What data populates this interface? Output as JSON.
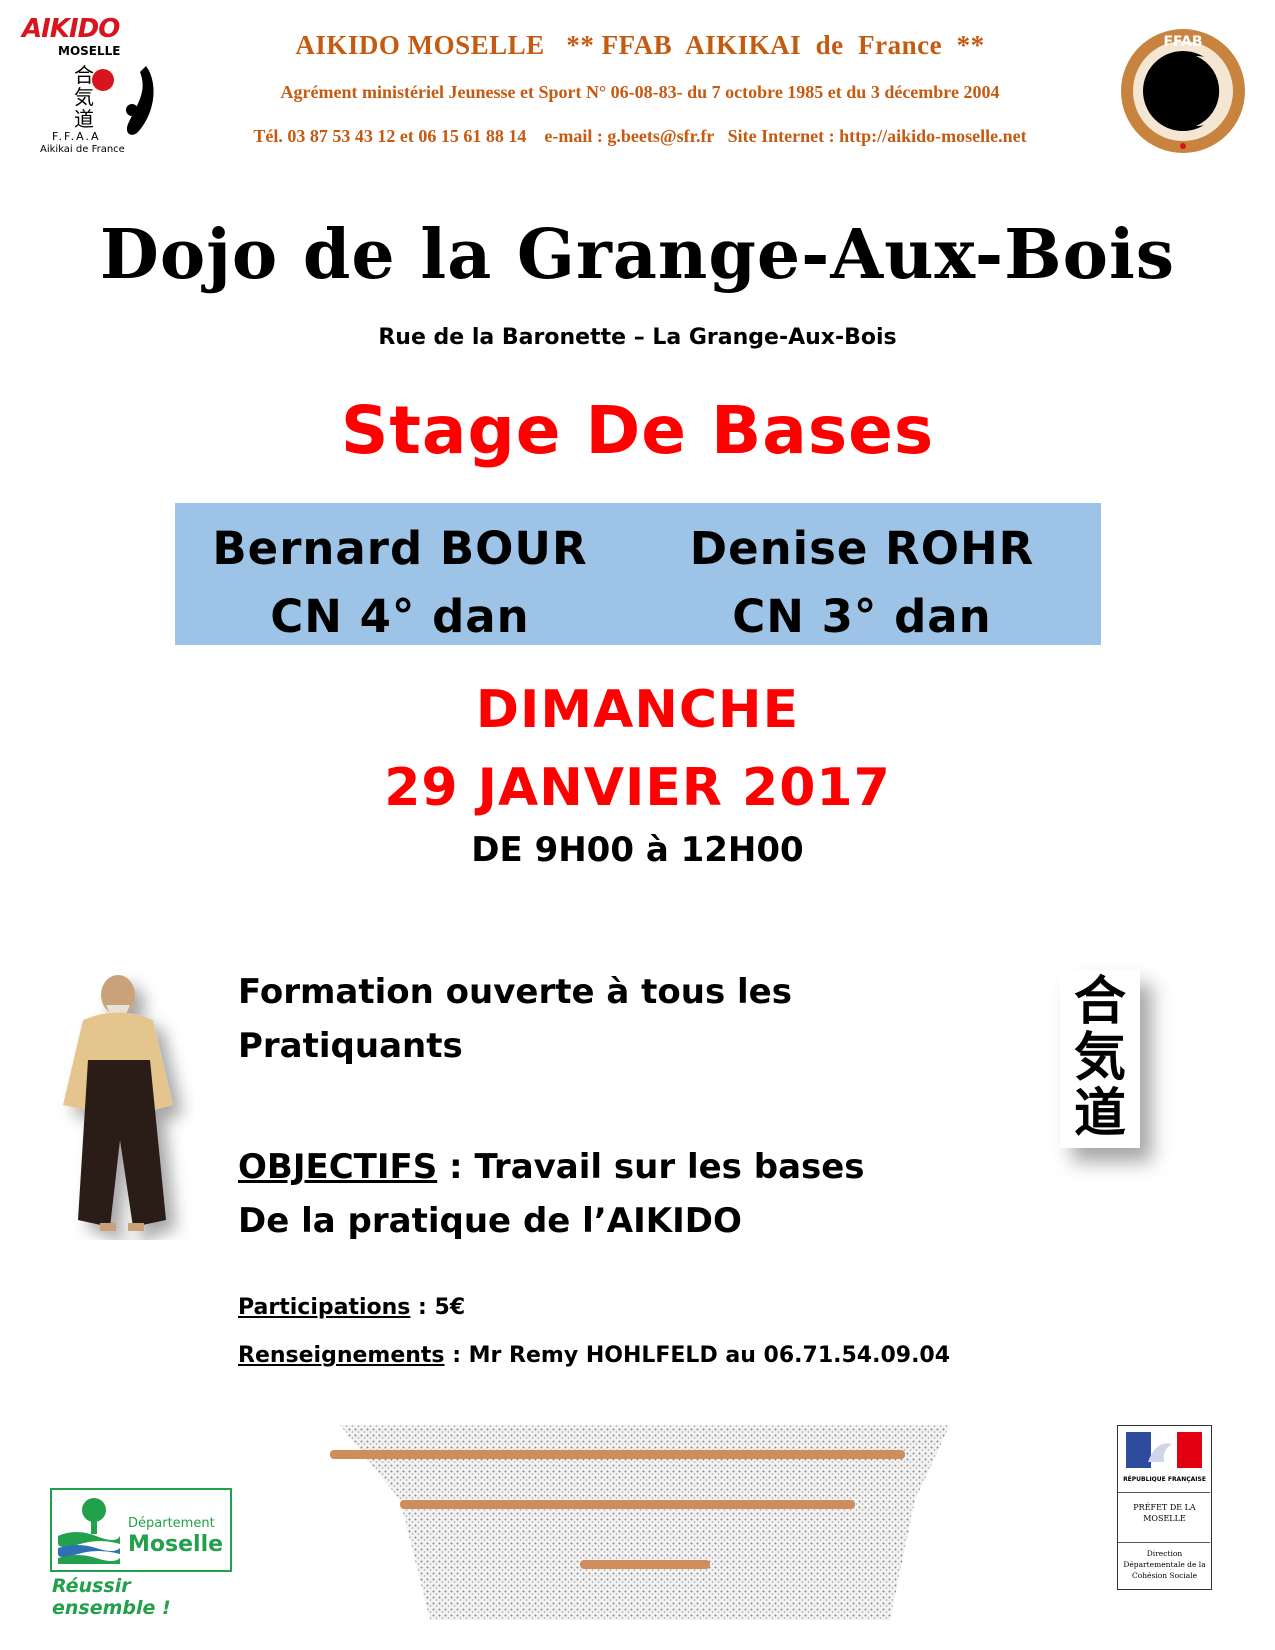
{
  "header": {
    "logo_left": {
      "brand": "AIKIDO",
      "sub": "MOSELLE",
      "ffaa": "F.F.A.A",
      "caption": "Aikikai de France"
    },
    "line1": "AIKIDO MOSELLE   ** FFAB  AIKIKAI  de  France  **",
    "line2": "Agrément ministériel Jeunesse et Sport N° 06-08-83- du 7 octobre 1985 et du 3 décembre 2004",
    "line3": "Tél. 03 87 53 43 12 et 06 15 61 88 14    e-mail : g.beets@sfr.fr   Site Internet : http://aikido-moselle.net",
    "logo_right_text": "FFAB"
  },
  "dojo_title": "Dojo de la Grange-Aux-Bois",
  "address": "Rue de la Baronette – La Grange-Aux-Bois",
  "stage_title": "Stage De Bases",
  "teachers": [
    {
      "name": "Bernard BOUR",
      "grade": "CN 4° dan"
    },
    {
      "name": "Denise ROHR",
      "grade": "CN 3° dan"
    }
  ],
  "day": "DIMANCHE",
  "date": "29 JANVIER 2017",
  "hours": "DE 9H00 à 12H00",
  "formation": {
    "line1": "Formation ouverte à tous les",
    "line2": "Pratiquants"
  },
  "objectifs": {
    "label": "OBJECTIFS",
    "text": " : Travail sur les bases",
    "line2": "De la pratique de l’AIKIDO"
  },
  "participations": {
    "label": "Participations",
    "value": " : 5€"
  },
  "renseignements": {
    "label": "Renseignements",
    "value": " : Mr Remy HOHLFELD au 06.71.54.09.04"
  },
  "kanji": [
    "合",
    "気",
    "道"
  ],
  "dept_logo": {
    "line1": "Département",
    "line2": "Moselle",
    "slogan": "Réussir ensemble !"
  },
  "prefet_logo": {
    "rep": "RÉPUBLIQUE FRANÇAISE",
    "prefet": "PRÉFET DE LA MOSELLE",
    "direction": "Direction Départementale de la Cohésion Sociale"
  },
  "colors": {
    "header": "#c55a11",
    "red": "#ff0000",
    "box": "#9dc3e6",
    "green": "#22a04b"
  }
}
